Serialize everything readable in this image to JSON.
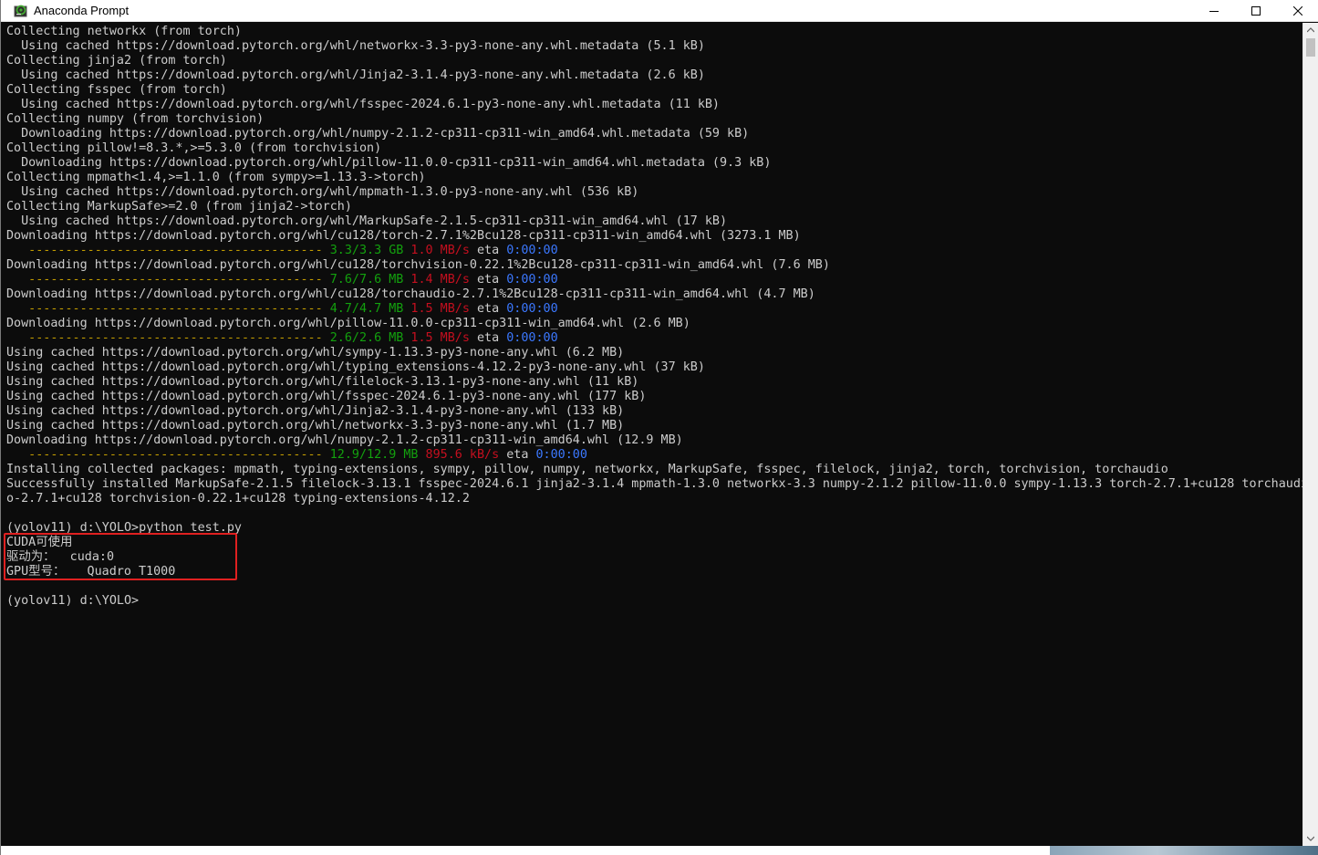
{
  "window": {
    "title": "Anaconda Prompt",
    "icons": {
      "app": "anaconda-prompt-icon",
      "minimize": "minimize-icon",
      "maximize": "maximize-icon",
      "close": "close-icon"
    }
  },
  "console": {
    "colors": {
      "default": "#cccccc",
      "progress_dash": "#c19c00",
      "progress_size": "#13a10e",
      "progress_rate": "#c50f1f",
      "progress_eta": "#3b78ff",
      "highlight_border": "#e02020"
    },
    "lines": [
      [
        {
          "t": "Collecting networkx (from torch)",
          "c": "w"
        }
      ],
      [
        {
          "t": "  Using cached https://download.pytorch.org/whl/networkx-3.3-py3-none-any.whl.metadata (5.1 kB)",
          "c": "w"
        }
      ],
      [
        {
          "t": "Collecting jinja2 (from torch)",
          "c": "w"
        }
      ],
      [
        {
          "t": "  Using cached https://download.pytorch.org/whl/Jinja2-3.1.4-py3-none-any.whl.metadata (2.6 kB)",
          "c": "w"
        }
      ],
      [
        {
          "t": "Collecting fsspec (from torch)",
          "c": "w"
        }
      ],
      [
        {
          "t": "  Using cached https://download.pytorch.org/whl/fsspec-2024.6.1-py3-none-any.whl.metadata (11 kB)",
          "c": "w"
        }
      ],
      [
        {
          "t": "Collecting numpy (from torchvision)",
          "c": "w"
        }
      ],
      [
        {
          "t": "  Downloading https://download.pytorch.org/whl/numpy-2.1.2-cp311-cp311-win_amd64.whl.metadata (59 kB)",
          "c": "w"
        }
      ],
      [
        {
          "t": "Collecting pillow!=8.3.*,>=5.3.0 (from torchvision)",
          "c": "w"
        }
      ],
      [
        {
          "t": "  Downloading https://download.pytorch.org/whl/pillow-11.0.0-cp311-cp311-win_amd64.whl.metadata (9.3 kB)",
          "c": "w"
        }
      ],
      [
        {
          "t": "Collecting mpmath<1.4,>=1.1.0 (from sympy>=1.13.3->torch)",
          "c": "w"
        }
      ],
      [
        {
          "t": "  Using cached https://download.pytorch.org/whl/mpmath-1.3.0-py3-none-any.whl (536 kB)",
          "c": "w"
        }
      ],
      [
        {
          "t": "Collecting MarkupSafe>=2.0 (from jinja2->torch)",
          "c": "w"
        }
      ],
      [
        {
          "t": "  Using cached https://download.pytorch.org/whl/MarkupSafe-2.1.5-cp311-cp311-win_amd64.whl (17 kB)",
          "c": "w"
        }
      ],
      [
        {
          "t": "Downloading https://download.pytorch.org/whl/cu128/torch-2.7.1%2Bcu128-cp311-cp311-win_amd64.whl (3273.1 MB)",
          "c": "w"
        }
      ],
      [
        {
          "t": "   ---------------------------------------- ",
          "c": "dash"
        },
        {
          "t": "3.3/3.3 GB",
          "c": "g"
        },
        {
          "t": " ",
          "c": "w"
        },
        {
          "t": "1.0 MB/s",
          "c": "r"
        },
        {
          "t": " eta ",
          "c": "w"
        },
        {
          "t": "0:00:00",
          "c": "b"
        }
      ],
      [
        {
          "t": "Downloading https://download.pytorch.org/whl/cu128/torchvision-0.22.1%2Bcu128-cp311-cp311-win_amd64.whl (7.6 MB)",
          "c": "w"
        }
      ],
      [
        {
          "t": "   ---------------------------------------- ",
          "c": "dash"
        },
        {
          "t": "7.6/7.6 MB",
          "c": "g"
        },
        {
          "t": " ",
          "c": "w"
        },
        {
          "t": "1.4 MB/s",
          "c": "r"
        },
        {
          "t": " eta ",
          "c": "w"
        },
        {
          "t": "0:00:00",
          "c": "b"
        }
      ],
      [
        {
          "t": "Downloading https://download.pytorch.org/whl/cu128/torchaudio-2.7.1%2Bcu128-cp311-cp311-win_amd64.whl (4.7 MB)",
          "c": "w"
        }
      ],
      [
        {
          "t": "   ---------------------------------------- ",
          "c": "dash"
        },
        {
          "t": "4.7/4.7 MB",
          "c": "g"
        },
        {
          "t": " ",
          "c": "w"
        },
        {
          "t": "1.5 MB/s",
          "c": "r"
        },
        {
          "t": " eta ",
          "c": "w"
        },
        {
          "t": "0:00:00",
          "c": "b"
        }
      ],
      [
        {
          "t": "Downloading https://download.pytorch.org/whl/pillow-11.0.0-cp311-cp311-win_amd64.whl (2.6 MB)",
          "c": "w"
        }
      ],
      [
        {
          "t": "   ---------------------------------------- ",
          "c": "dash"
        },
        {
          "t": "2.6/2.6 MB",
          "c": "g"
        },
        {
          "t": " ",
          "c": "w"
        },
        {
          "t": "1.5 MB/s",
          "c": "r"
        },
        {
          "t": " eta ",
          "c": "w"
        },
        {
          "t": "0:00:00",
          "c": "b"
        }
      ],
      [
        {
          "t": "Using cached https://download.pytorch.org/whl/sympy-1.13.3-py3-none-any.whl (6.2 MB)",
          "c": "w"
        }
      ],
      [
        {
          "t": "Using cached https://download.pytorch.org/whl/typing_extensions-4.12.2-py3-none-any.whl (37 kB)",
          "c": "w"
        }
      ],
      [
        {
          "t": "Using cached https://download.pytorch.org/whl/filelock-3.13.1-py3-none-any.whl (11 kB)",
          "c": "w"
        }
      ],
      [
        {
          "t": "Using cached https://download.pytorch.org/whl/fsspec-2024.6.1-py3-none-any.whl (177 kB)",
          "c": "w"
        }
      ],
      [
        {
          "t": "Using cached https://download.pytorch.org/whl/Jinja2-3.1.4-py3-none-any.whl (133 kB)",
          "c": "w"
        }
      ],
      [
        {
          "t": "Using cached https://download.pytorch.org/whl/networkx-3.3-py3-none-any.whl (1.7 MB)",
          "c": "w"
        }
      ],
      [
        {
          "t": "Downloading https://download.pytorch.org/whl/numpy-2.1.2-cp311-cp311-win_amd64.whl (12.9 MB)",
          "c": "w"
        }
      ],
      [
        {
          "t": "   ---------------------------------------- ",
          "c": "dash"
        },
        {
          "t": "12.9/12.9 MB",
          "c": "g"
        },
        {
          "t": " ",
          "c": "w"
        },
        {
          "t": "895.6 kB/s",
          "c": "r"
        },
        {
          "t": " eta ",
          "c": "w"
        },
        {
          "t": "0:00:00",
          "c": "b"
        }
      ],
      [
        {
          "t": "Installing collected packages: mpmath, typing-extensions, sympy, pillow, numpy, networkx, MarkupSafe, fsspec, filelock, jinja2, torch, torchvision, torchaudio",
          "c": "w"
        }
      ],
      [
        {
          "t": "Successfully installed MarkupSafe-2.1.5 filelock-3.13.1 fsspec-2024.6.1 jinja2-3.1.4 mpmath-1.3.0 networkx-3.3 numpy-2.1.2 pillow-11.0.0 sympy-1.13.3 torch-2.7.1+cu128 torchaudi",
          "c": "w"
        }
      ],
      [
        {
          "t": "o-2.7.1+cu128 torchvision-0.22.1+cu128 typing-extensions-4.12.2",
          "c": "w"
        }
      ],
      [
        {
          "t": "",
          "c": "w"
        }
      ],
      [
        {
          "t": "(yolov11) d:\\YOLO>python test.py",
          "c": "w"
        }
      ],
      [
        {
          "t": "CUDA可使用",
          "c": "w"
        }
      ],
      [
        {
          "t": "驱动为：  cuda:0",
          "c": "w"
        }
      ],
      [
        {
          "t": "GPU型号：   Quadro T1000",
          "c": "w"
        }
      ],
      [
        {
          "t": "",
          "c": "w"
        }
      ],
      [
        {
          "t": "(yolov11) d:\\YOLO>",
          "c": "w"
        }
      ]
    ]
  },
  "scrollbar": {
    "up_icon": "scroll-up-arrow-icon",
    "down_icon": "scroll-down-arrow-icon"
  }
}
